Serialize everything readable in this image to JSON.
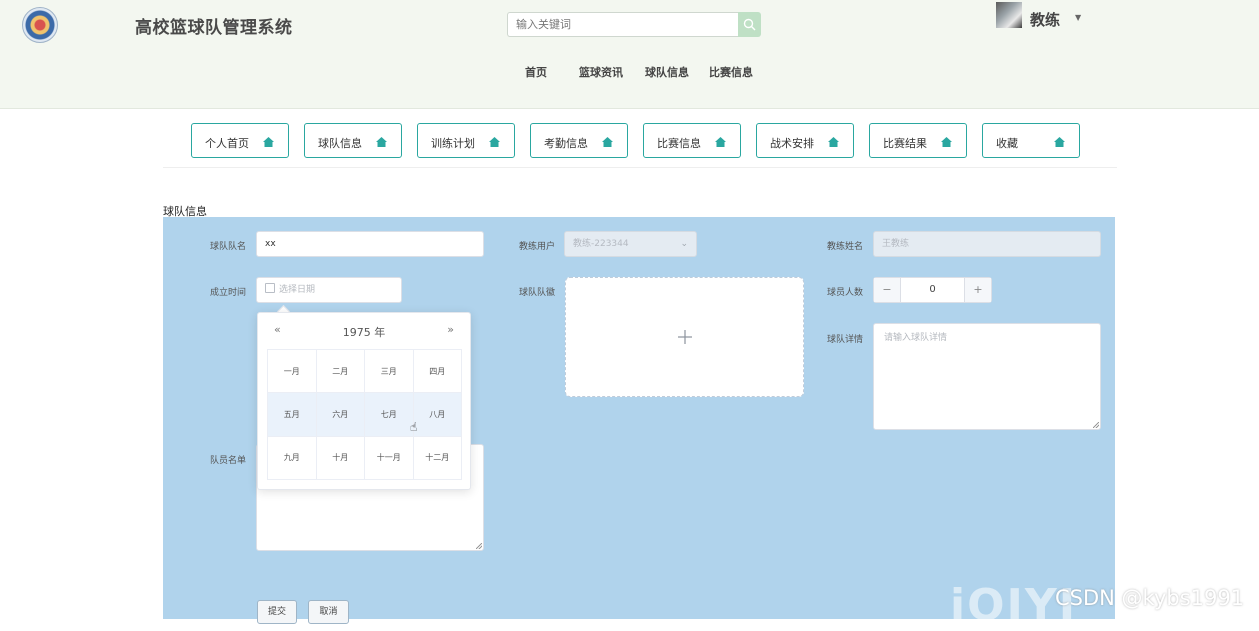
{
  "header": {
    "title": "高校篮球队管理系统",
    "search_placeholder": "输入关键词",
    "user_name": "教练",
    "nav": [
      "首页",
      "篮球资讯",
      "球队信息",
      "比赛信息"
    ]
  },
  "tabs": [
    "个人首页",
    "球队信息",
    "训练计划",
    "考勤信息",
    "比赛信息",
    "战术安排",
    "比赛结果",
    "收藏"
  ],
  "form": {
    "section_title": "球队信息",
    "team_name_label": "球队队名",
    "team_name_value": "xx",
    "coach_user_label": "教练用户",
    "coach_user_value": "教练-223344",
    "coach_name_label": "教练姓名",
    "coach_name_value": "王教练",
    "founded_label": "成立时间",
    "founded_placeholder": "选择日期",
    "logo_label": "球队队徽",
    "player_count_label": "球员人数",
    "player_count_value": "0",
    "details_label": "球队详情",
    "details_placeholder": "请输入球队详情",
    "roster_label": "队员名单",
    "submit_label": "提交",
    "cancel_label": "取消"
  },
  "date_picker": {
    "prev": "«",
    "next": "»",
    "year": "1975 年",
    "months": [
      "一月",
      "二月",
      "三月",
      "四月",
      "五月",
      "六月",
      "七月",
      "八月",
      "九月",
      "十月",
      "十一月",
      "十二月"
    ]
  },
  "watermark": {
    "logo": "iQIYI",
    "text": "CSDN @kybs1991"
  },
  "colors": {
    "accent": "#2aa7a0",
    "panel": "#b0d3ec",
    "header_bg": "#f3f7f0"
  }
}
